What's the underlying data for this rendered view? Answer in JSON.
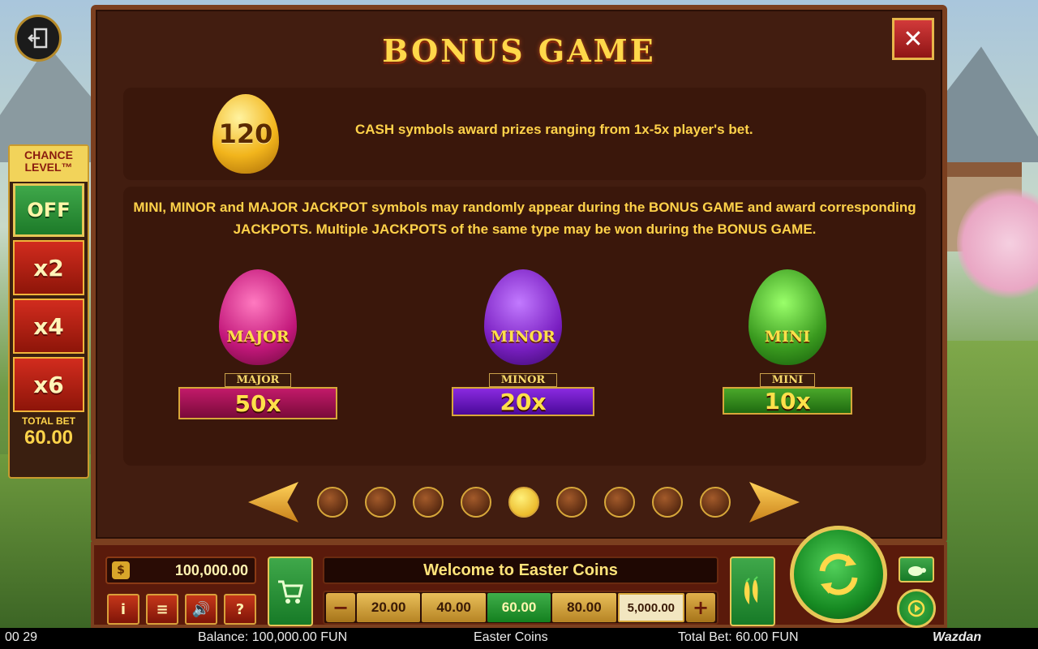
{
  "title": "BONUS GAME",
  "close_label": "✕",
  "exit_icon": "exit-icon",
  "chance_level": {
    "title": "CHANCE LEVEL™",
    "off_label": "OFF",
    "multipliers": [
      "x2",
      "x4",
      "x6"
    ],
    "total_bet_label": "TOTAL BET",
    "total_bet_value": "60.00"
  },
  "cash": {
    "egg_value": "120",
    "text": "CASH symbols award prizes ranging from 1x-5x player's bet."
  },
  "jackpot_text": "MINI, MINOR and MAJOR JACKPOT symbols may randomly appear during the BONUS GAME and award corresponding JACKPOTS. Multiple JACKPOTS of the same type may be won during the BONUS GAME.",
  "jackpots": [
    {
      "name": "MAJOR",
      "tag": "MAJOR",
      "value": "50x",
      "color": "#c2177a"
    },
    {
      "name": "MINOR",
      "tag": "MINOR",
      "value": "20x",
      "color": "#7a1fc2"
    },
    {
      "name": "MINI",
      "tag": "MINI",
      "value": "10x",
      "color": "#3a9a1f"
    }
  ],
  "pager": {
    "pages": 9,
    "active_page": 5
  },
  "bar": {
    "balance": "100,000.00",
    "coin_glyph": "$",
    "welcome": "Welcome to Easter Coins",
    "buttons": {
      "info": "i",
      "menu": "≡",
      "sound": "🔊",
      "help": "?"
    },
    "minus": "−",
    "plus": "+",
    "bets": [
      "20.00",
      "40.00",
      "60.00",
      "80.00",
      "5,000.00"
    ],
    "selected_bet": "60.00"
  },
  "status": {
    "time": "00 29",
    "balance": "Balance: 100,000.00 FUN",
    "game": "Easter Coins",
    "total_bet": "Total Bet: 60.00 FUN",
    "brand": "Wazdan"
  }
}
